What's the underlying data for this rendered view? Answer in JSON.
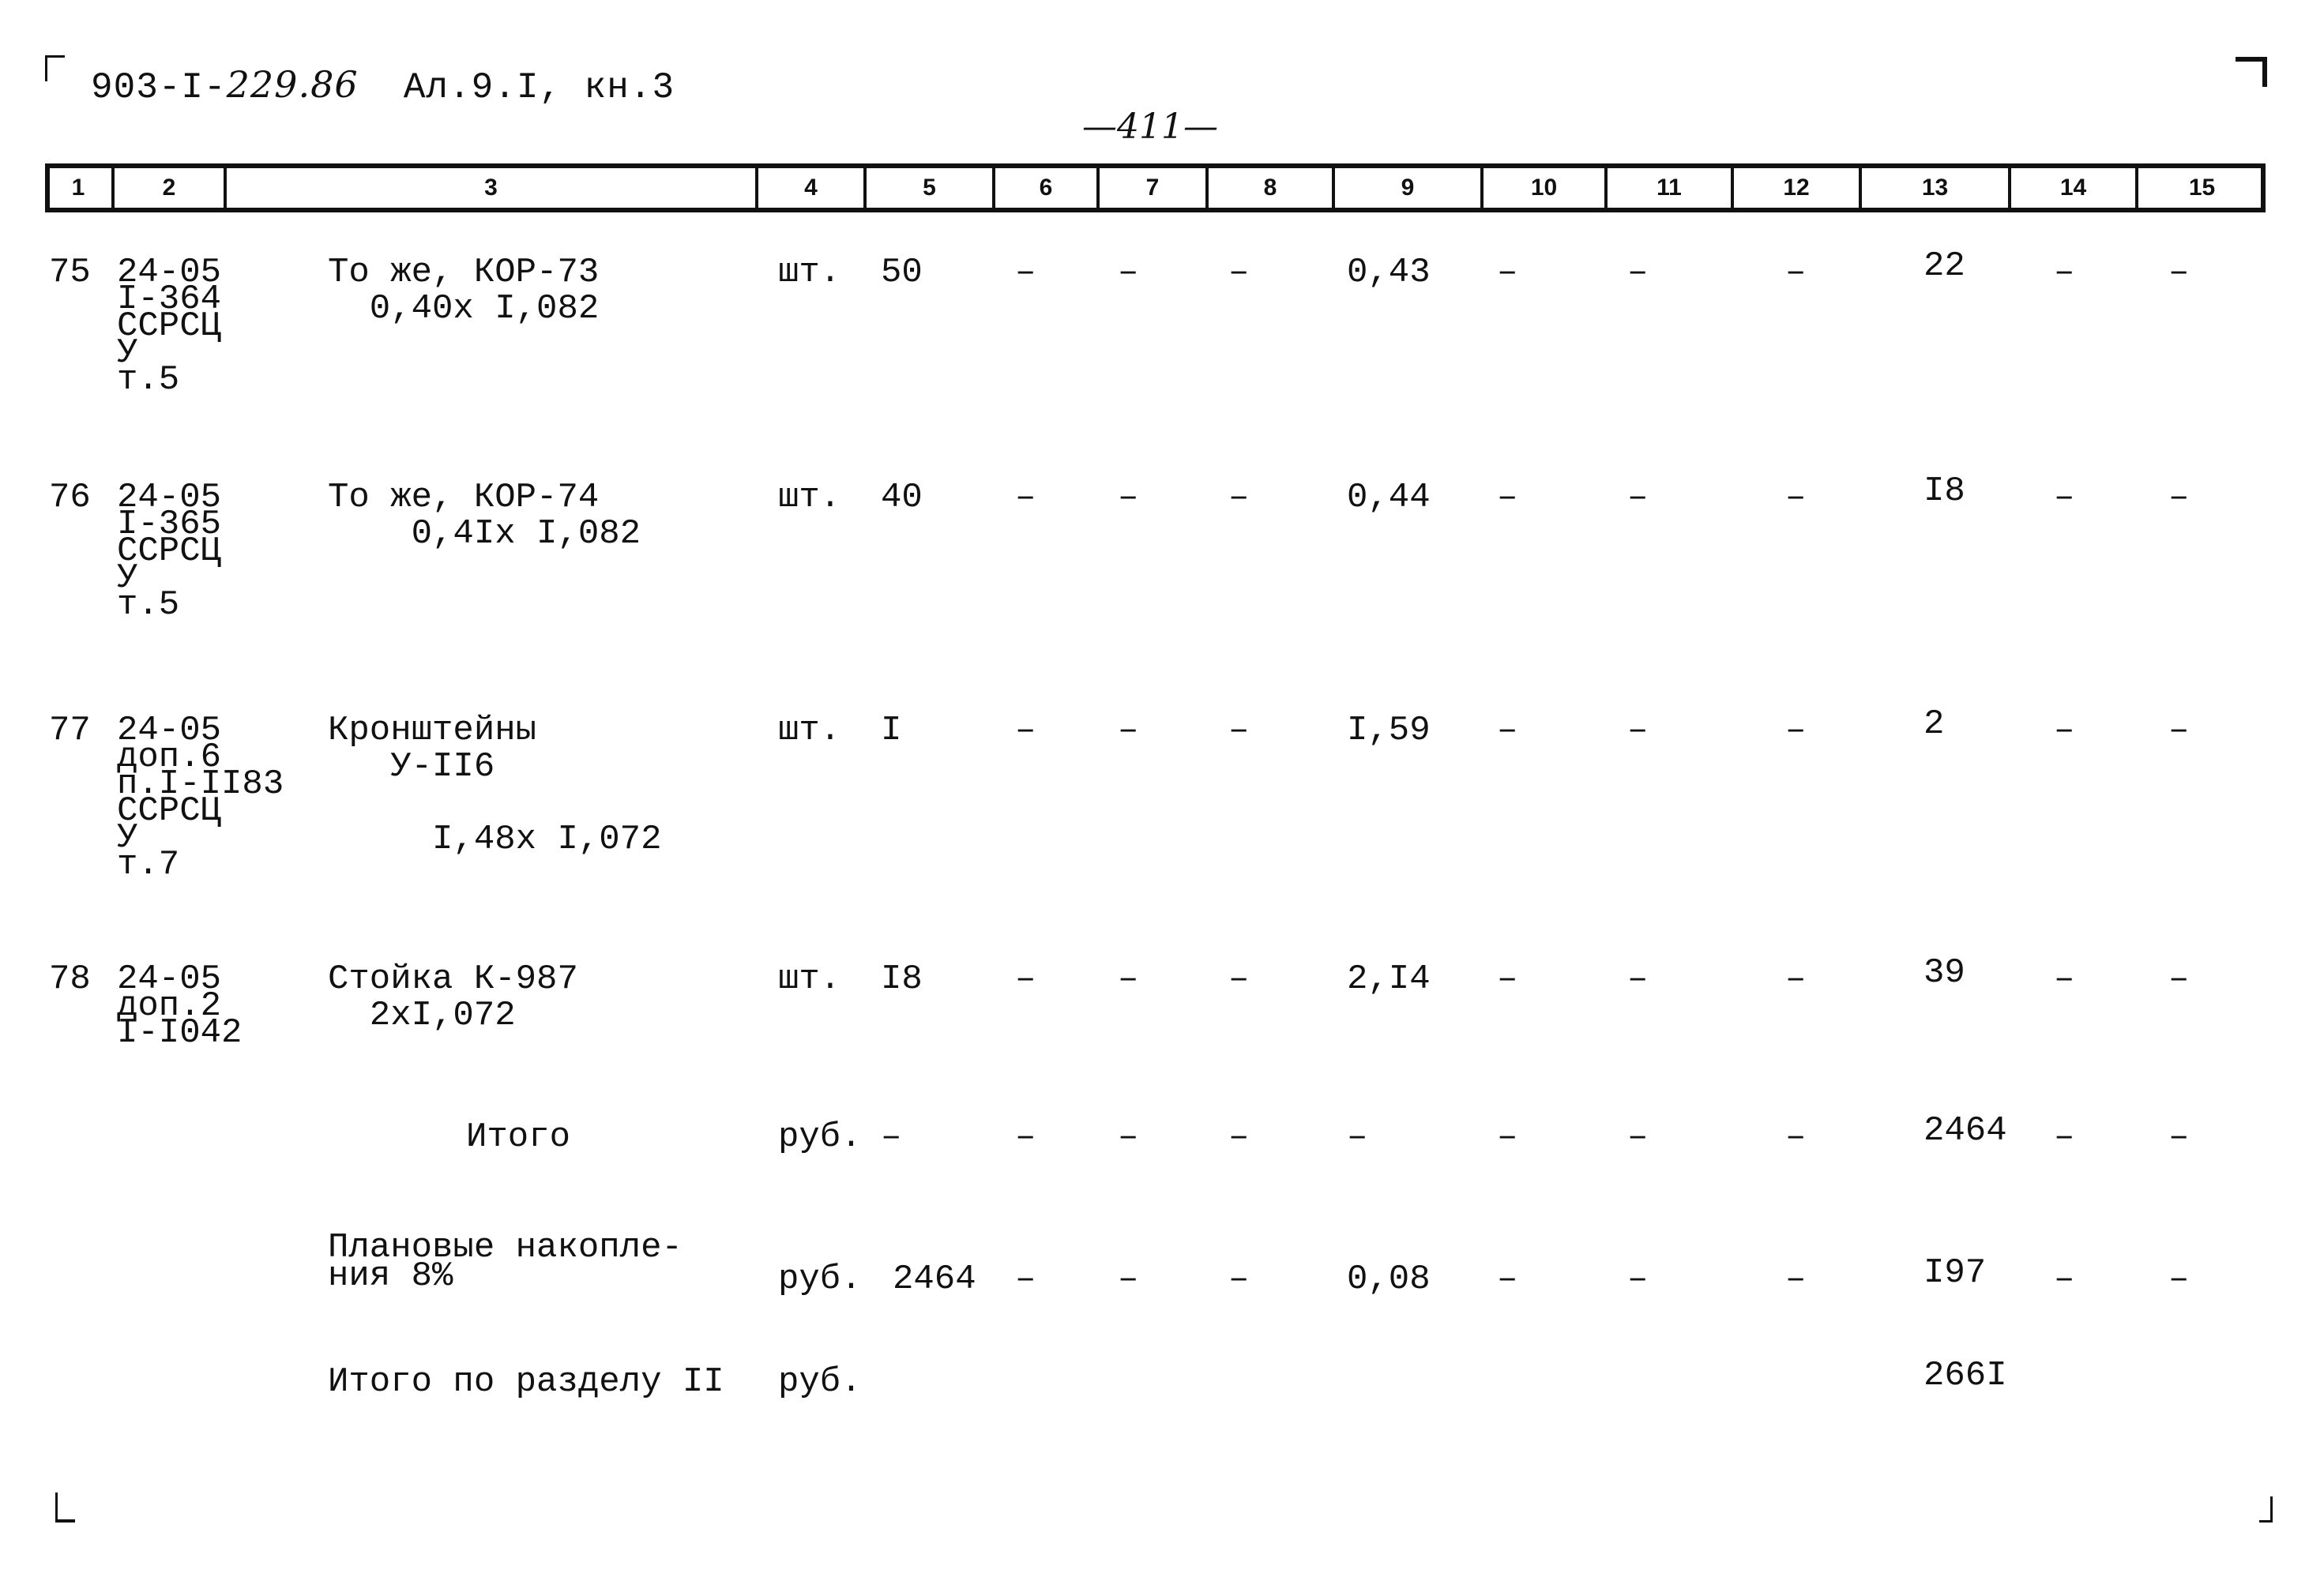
{
  "document": {
    "code_prefix": "903-I-",
    "code_italic": "229.86",
    "code_suffix": "  Ал.9.I, кн.3",
    "page_number": "—411—"
  },
  "table": {
    "columns": [
      "1",
      "2",
      "3",
      "4",
      "5",
      "6",
      "7",
      "8",
      "9",
      "10",
      "11",
      "12",
      "13",
      "14",
      "15"
    ],
    "rows": [
      {
        "no": "75",
        "ref": [
          "24-05",
          "I-364",
          "ССРСЦ",
          "У",
          "т.5"
        ],
        "name": [
          "То же, КОР-73",
          "  0,40х I,082"
        ],
        "unit": "шт.",
        "c5": "50",
        "c6": "–",
        "c7": "–",
        "c8": "–",
        "c9": "0,43",
        "c10": "–",
        "c11": "–",
        "c12": "–",
        "c13": "22",
        "c14": "–",
        "c15": "–"
      },
      {
        "no": "76",
        "ref": [
          "24-05",
          "I-365",
          "ССРСЦ",
          "У",
          "т.5"
        ],
        "name": [
          "То же, КОР-74",
          "    0,4Iх I,082"
        ],
        "unit": "шт.",
        "c5": "40",
        "c6": "–",
        "c7": "–",
        "c8": "–",
        "c9": "0,44",
        "c10": "–",
        "c11": "–",
        "c12": "–",
        "c13": "I8",
        "c14": "–",
        "c15": "–"
      },
      {
        "no": "77",
        "ref": [
          "24-05",
          "доп.6",
          "п.I-II83",
          "ССРСЦ",
          "У",
          "т.7"
        ],
        "name": [
          "Кронштейны",
          "   У-II6",
          "",
          "     I,48х I,072"
        ],
        "unit": "шт.",
        "c5": "I",
        "c6": "–",
        "c7": "–",
        "c8": "–",
        "c9": "I,59",
        "c10": "–",
        "c11": "–",
        "c12": "–",
        "c13": "2",
        "c14": "–",
        "c15": "–"
      },
      {
        "no": "78",
        "ref": [
          "24-05",
          "доп.2",
          "I-I042"
        ],
        "name": [
          "Стойка К-987",
          "  2хI,072"
        ],
        "unit": "шт.",
        "c5": "I8",
        "c6": "–",
        "c7": "–",
        "c8": "–",
        "c9": "2,I4",
        "c10": "–",
        "c11": "–",
        "c12": "–",
        "c13": "39",
        "c14": "–",
        "c15": "–"
      }
    ],
    "totals": [
      {
        "label": [
          "Итого"
        ],
        "unit": "руб.",
        "c5": "–",
        "c6": "–",
        "c7": "–",
        "c8": "–",
        "c9": "–",
        "c10": "–",
        "c11": "–",
        "c12": "–",
        "c13": "2464",
        "c14": "–",
        "c15": "–"
      },
      {
        "label": [
          "Плановые накопле-",
          "ния 8%"
        ],
        "unit": "руб.",
        "c5": "2464",
        "c6": "–",
        "c7": "–",
        "c8": "–",
        "c9": "0,08",
        "c10": "–",
        "c11": "–",
        "c12": "–",
        "c13": "I97",
        "c14": "–",
        "c15": "–"
      },
      {
        "label": [
          "Итого по разделу II"
        ],
        "unit": "руб.",
        "c13": "266I"
      }
    ]
  }
}
